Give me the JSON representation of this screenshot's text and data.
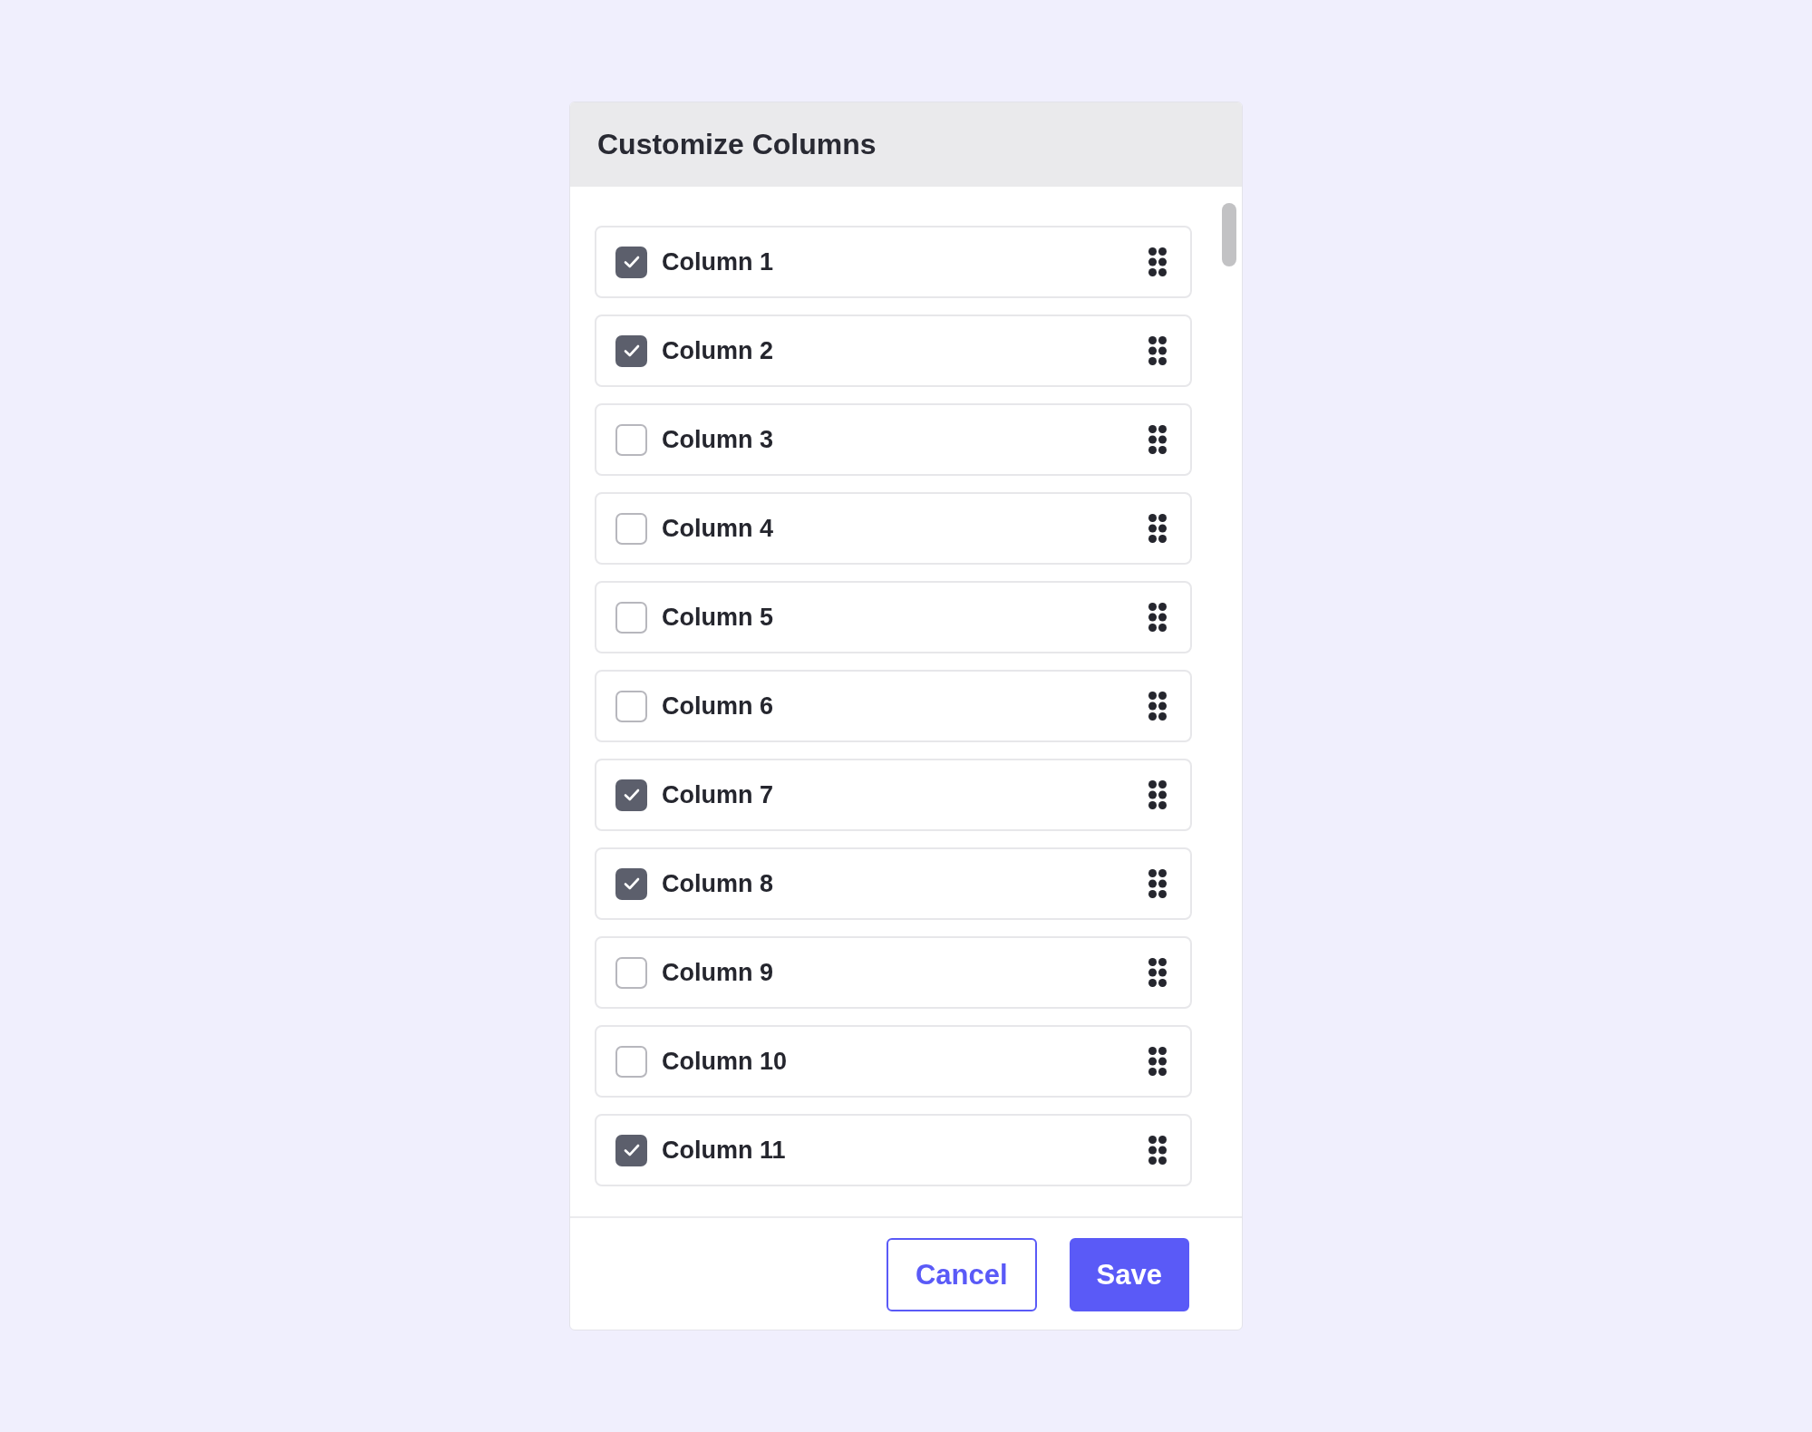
{
  "dialog": {
    "title": "Customize Columns",
    "columns": [
      {
        "label": "Column 1",
        "checked": true
      },
      {
        "label": "Column 2",
        "checked": true
      },
      {
        "label": "Column 3",
        "checked": false
      },
      {
        "label": "Column 4",
        "checked": false
      },
      {
        "label": "Column 5",
        "checked": false
      },
      {
        "label": "Column 6",
        "checked": false
      },
      {
        "label": "Column 7",
        "checked": true
      },
      {
        "label": "Column 8",
        "checked": true
      },
      {
        "label": "Column 9",
        "checked": false
      },
      {
        "label": "Column 10",
        "checked": false
      },
      {
        "label": "Column 11",
        "checked": true
      }
    ],
    "buttons": [
      {
        "label": "Cancel",
        "kind": "outline"
      },
      {
        "label": "Save",
        "kind": "filled"
      }
    ]
  }
}
